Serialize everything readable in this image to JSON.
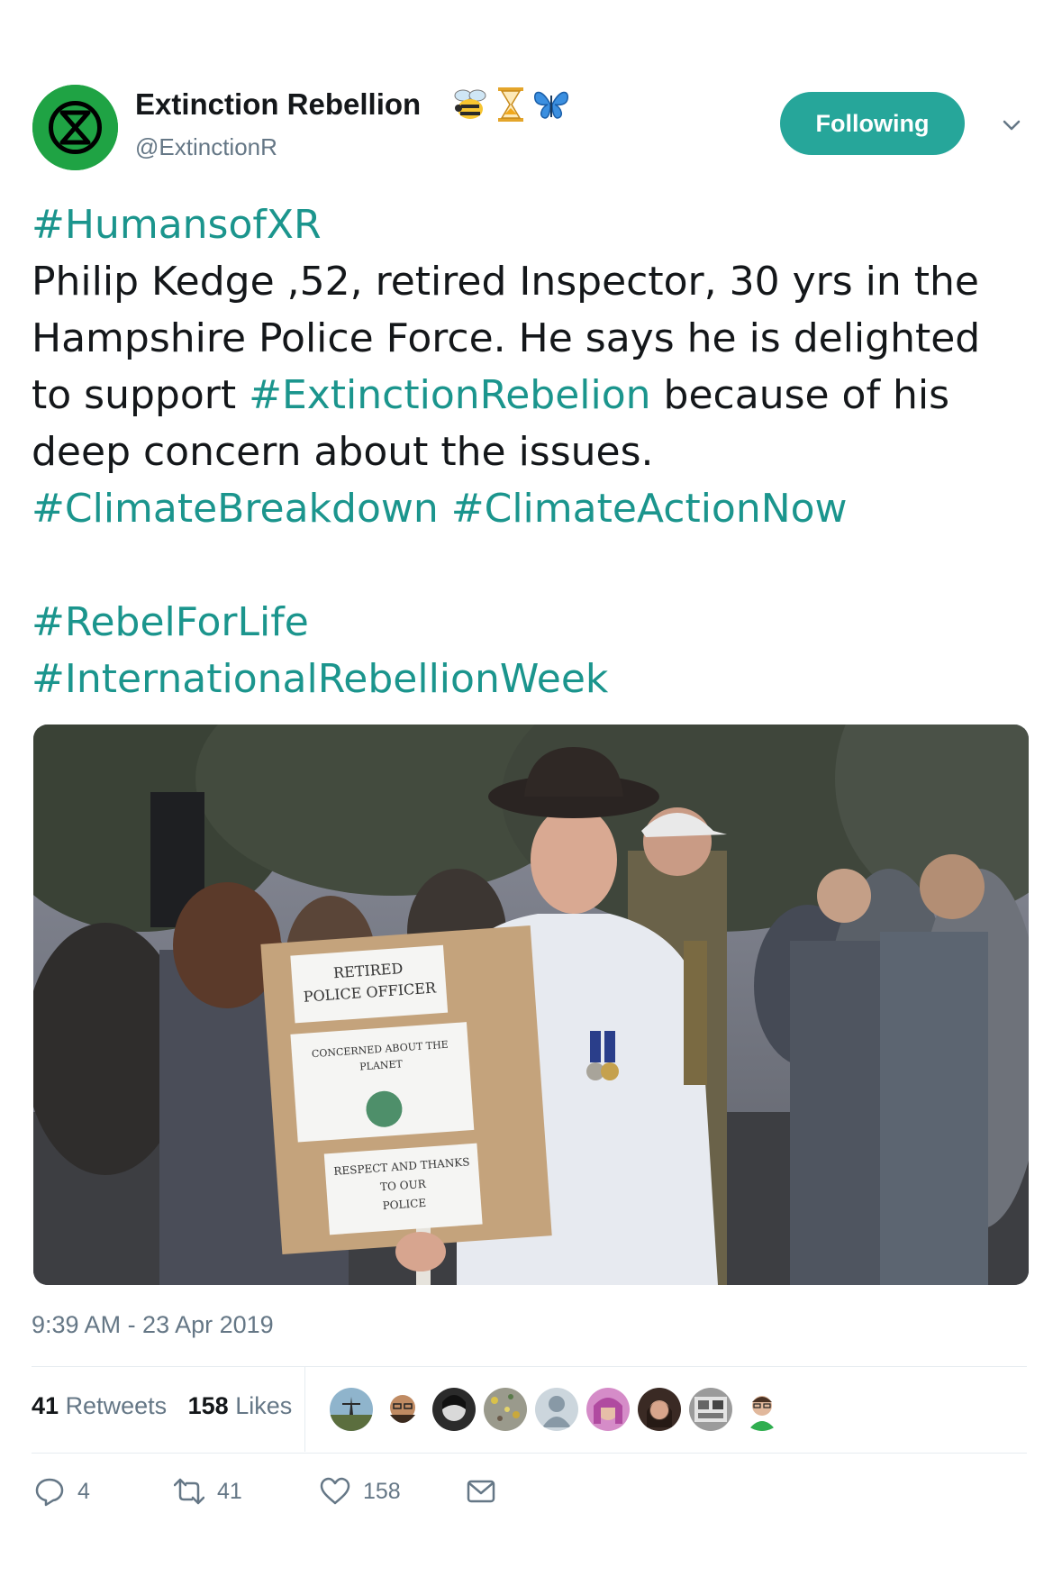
{
  "account": {
    "display_name": "Extinction Rebellion",
    "handle": "@ExtinctionR",
    "name_emojis": [
      "bee-emoji",
      "hourglass-emoji",
      "butterfly-emoji"
    ],
    "avatar_icon": "extinction-symbol-icon",
    "brand_color": "#1fa344"
  },
  "follow_button": {
    "label": "Following",
    "color": "#26a69a"
  },
  "tweet": {
    "hashtag_color": "#1b958d",
    "line1_tag": "#HumansofXR",
    "body_part1": "Philip Kedge ,52, retired Inspector, 30 yrs in the Hampshire Police Force. He says he is delighted to support ",
    "tag_rebelion": "#ExtinctionRebelion",
    "body_part2": " because of his deep concern about the issues. ",
    "tag_breakdown": "#ClimateBreakdown",
    "tag_actionnow": "#ClimateActionNow",
    "tag_rebelforlife": "#RebelForLife",
    "tag_intlweek": "#InternationalRebellionWeek"
  },
  "photo": {
    "sign_top": [
      "RETIRED",
      "POLICE OFFICER"
    ],
    "sign_middle": [
      "CONCERNED ABOUT THE",
      "PLANET"
    ],
    "sign_bottom": [
      "RESPECT AND THANKS",
      "TO OUR",
      "POLICE"
    ]
  },
  "timestamp": "9:39 AM - 23 Apr 2019",
  "stats": {
    "retweets_count": "41",
    "retweets_label": "Retweets",
    "likes_count": "158",
    "likes_label": "Likes",
    "liker_avatar_count": 9
  },
  "actions": {
    "reply_count": "4",
    "retweet_count": "41",
    "like_count": "158",
    "reply_icon": "reply-icon",
    "retweet_icon": "retweet-icon",
    "like_icon": "heart-icon",
    "dm_icon": "envelope-icon"
  }
}
